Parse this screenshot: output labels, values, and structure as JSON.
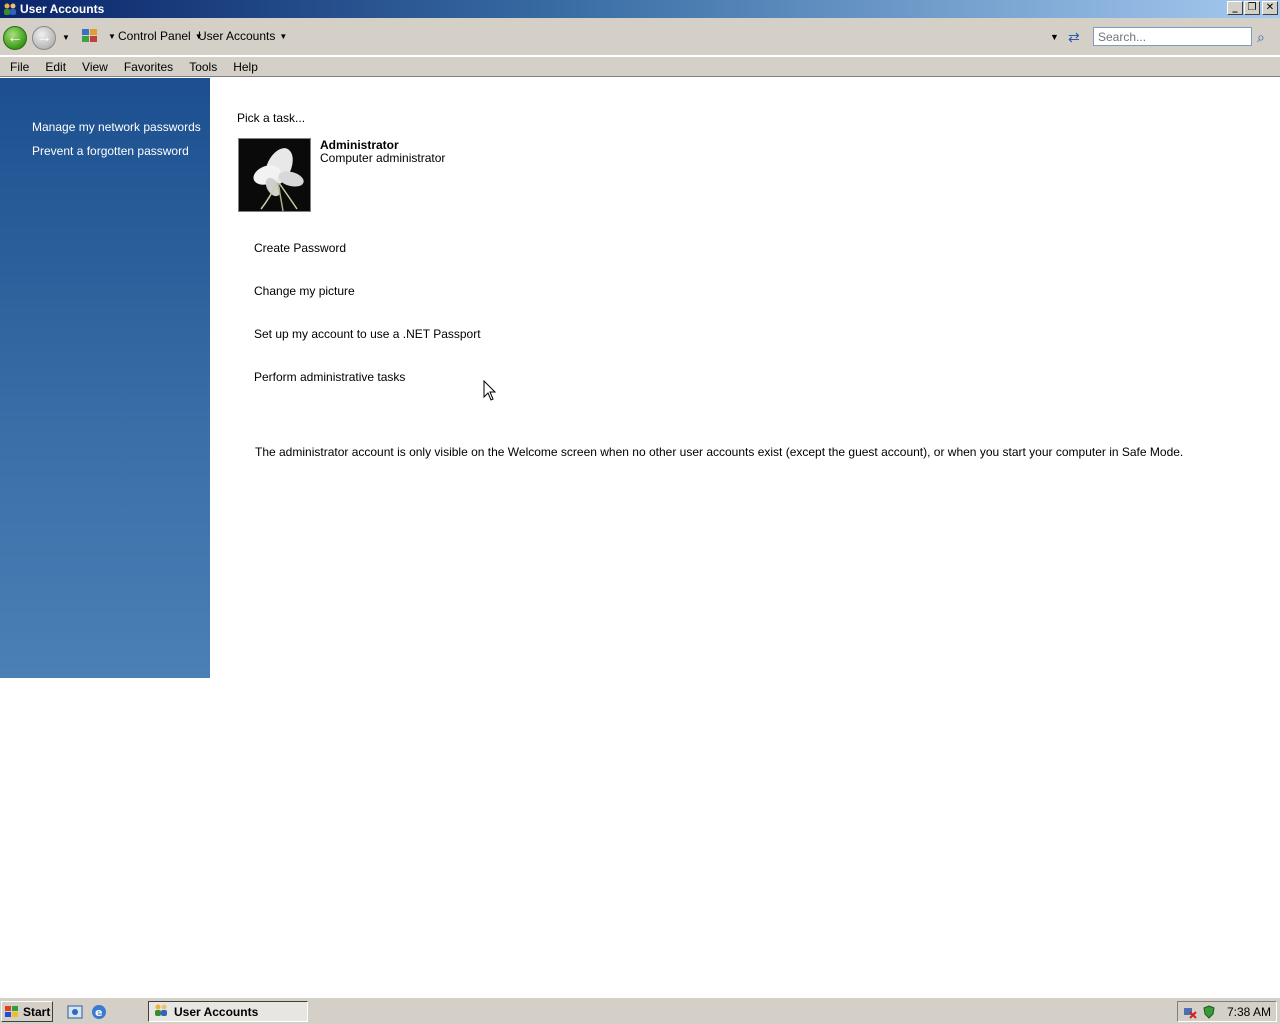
{
  "window": {
    "title": "User Accounts",
    "caption_buttons": {
      "minimize": "_",
      "restore": "❐",
      "close": "✕"
    }
  },
  "toolbar": {
    "back_icon": "back-arrow-icon",
    "forward_icon": "forward-arrow-icon",
    "breadcrumb": [
      "Control Panel",
      "User Accounts"
    ],
    "search": {
      "placeholder": "Search...",
      "value": ""
    }
  },
  "menu": [
    "File",
    "Edit",
    "View",
    "Favorites",
    "Tools",
    "Help"
  ],
  "sidebar": {
    "links": [
      "Manage my network passwords",
      "Prevent a forgotten password"
    ]
  },
  "main": {
    "heading": "Pick a task...",
    "account": {
      "name": "Administrator",
      "role": "Computer administrator"
    },
    "tasks": [
      "Create Password",
      "Change my picture",
      "Set up my account to use a .NET Passport",
      "Perform administrative tasks"
    ],
    "note": "The administrator account is only visible on the Welcome screen when no other user accounts exist (except the guest account), or when you start your computer in Safe Mode."
  },
  "taskbar": {
    "start_label": "Start",
    "active_window": "User Accounts",
    "clock": "7:38 AM"
  },
  "colors": {
    "sidebar_top": "#1c4f8f",
    "sidebar_bottom": "#4a80b5",
    "titlebar": "#0a246a"
  }
}
